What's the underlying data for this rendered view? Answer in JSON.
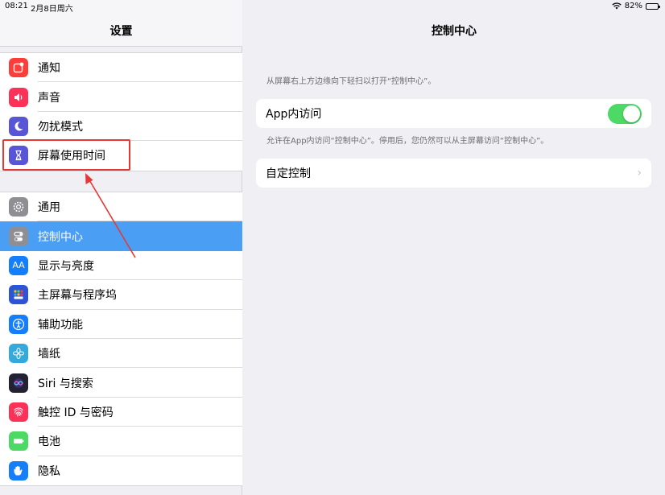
{
  "status": {
    "time": "08:21",
    "date": "2月8日周六",
    "battery": "82%",
    "battery_level": 0.82
  },
  "sidebar": {
    "title": "设置",
    "group1": [
      {
        "label": "通知",
        "icon": "notification-icon",
        "color": "#fc3d39"
      },
      {
        "label": "声音",
        "icon": "speaker-icon",
        "color": "#fc3158"
      },
      {
        "label": "勿扰模式",
        "icon": "moon-icon",
        "color": "#5856d6"
      },
      {
        "label": "屏幕使用时间",
        "icon": "hourglass-icon",
        "color": "#5856d6"
      }
    ],
    "group2": [
      {
        "label": "通用",
        "icon": "gear-icon",
        "color": "#8e8e93"
      },
      {
        "label": "控制中心",
        "icon": "switches-icon",
        "color": "#8e8e93",
        "selected": true
      },
      {
        "label": "显示与亮度",
        "icon": "text-size-icon",
        "color": "#147efb"
      },
      {
        "label": "主屏幕与程序坞",
        "icon": "home-grid-icon",
        "color": "#2c55d6"
      },
      {
        "label": "辅助功能",
        "icon": "accessibility-icon",
        "color": "#147efb"
      },
      {
        "label": "墙纸",
        "icon": "flower-icon",
        "color": "#34aadc"
      },
      {
        "label": "Siri 与搜索",
        "icon": "siri-icon",
        "color": "#222233"
      },
      {
        "label": "触控 ID 与密码",
        "icon": "fingerprint-icon",
        "color": "#fc3158"
      },
      {
        "label": "电池",
        "icon": "battery-icon",
        "color": "#4cd964"
      },
      {
        "label": "隐私",
        "icon": "hand-icon",
        "color": "#147efb"
      }
    ]
  },
  "detail": {
    "title": "控制中心",
    "top_note": "从屏幕右上方边缘向下轻扫以打开“控制中心”。",
    "app_access_label": "App内访问",
    "app_access_on": true,
    "app_access_note": "允许在App内访问“控制中心”。停用后，您仍然可以从主屏幕访问“控制中心”。",
    "customize_label": "自定控制",
    "chevron": "›"
  },
  "colors": {
    "accent": "#4a9ff5",
    "toggle_on": "#4cd964",
    "annotation": "#e53935"
  }
}
